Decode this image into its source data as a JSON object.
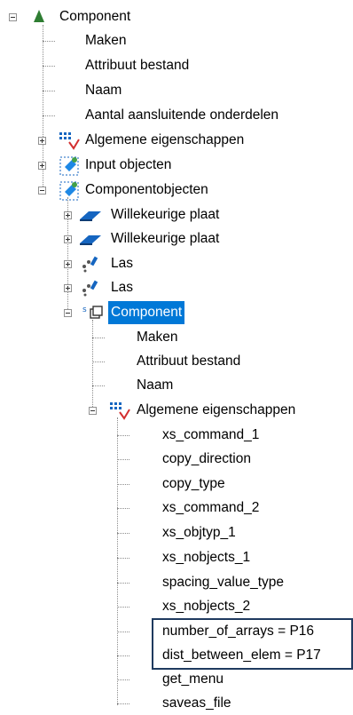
{
  "tree": {
    "root": {
      "label": "Component"
    },
    "root_children": {
      "maken": "Maken",
      "attribuut": "Attribuut bestand",
      "naam": "Naam",
      "aantal": "Aantal aansluitende onderdelen",
      "algemene": "Algemene eigenschappen",
      "input": "Input objecten",
      "componentobjecten": "Componentobjecten"
    },
    "componentobjecten_children": {
      "plaat1": "Willekeurige plaat",
      "plaat2": "Willekeurige plaat",
      "las1": "Las",
      "las2": "Las",
      "component": "Component"
    },
    "sub_component": {
      "maken": "Maken",
      "attribuut": "Attribuut bestand",
      "naam": "Naam",
      "algemene": "Algemene eigenschappen"
    },
    "properties": [
      "xs_command_1",
      "copy_direction",
      "copy_type",
      "xs_command_2",
      "xs_objtyp_1",
      "xs_nobjects_1",
      "spacing_value_type",
      "xs_nobjects_2",
      "number_of_arrays = P16",
      "dist_between_elem = P17",
      "get_menu",
      "saveas_file"
    ]
  },
  "colors": {
    "selection": "#0078d7",
    "highlight_border": "#1f3a5f"
  }
}
